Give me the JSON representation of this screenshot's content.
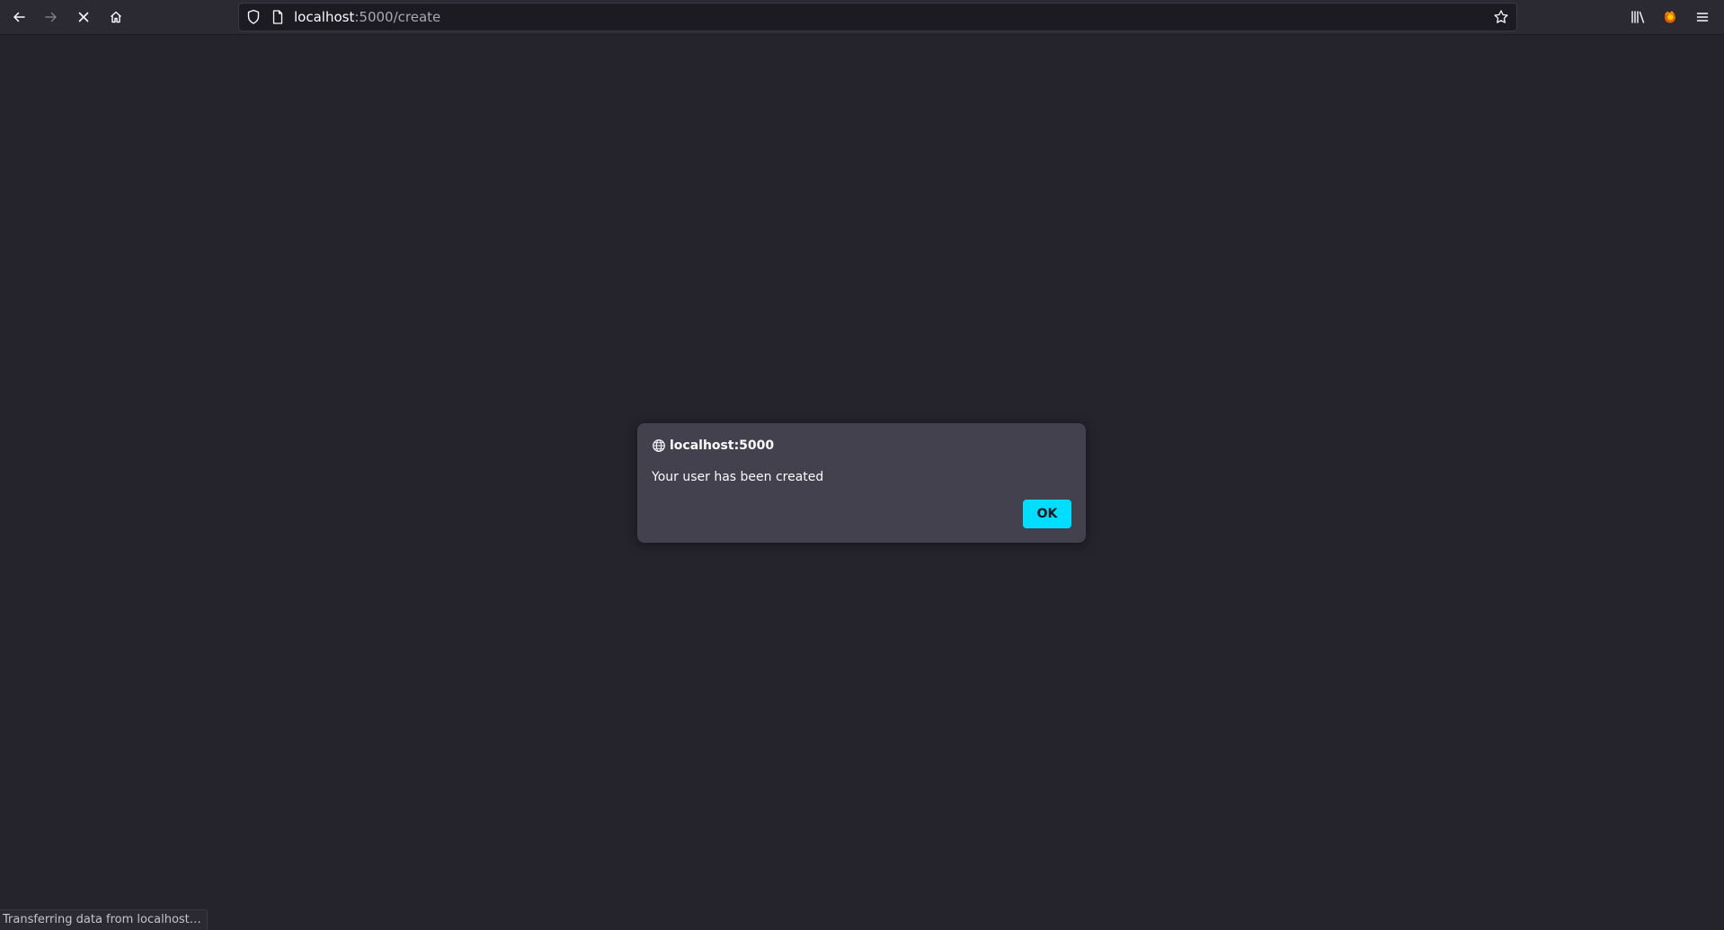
{
  "toolbar": {
    "back_icon": "arrow-left-icon",
    "forward_icon": "arrow-right-icon",
    "stop_icon": "close-icon",
    "home_icon": "home-icon",
    "library_icon": "library-icon",
    "extension_icon": "firefox-icon",
    "menu_icon": "hamburger-menu-icon"
  },
  "urlbar": {
    "host": "localhost",
    "path": ":5000/create",
    "shield_icon": "shield-icon",
    "page_icon": "page-icon",
    "star_icon": "star-icon"
  },
  "dialog": {
    "origin_icon": "globe-icon",
    "title": "localhost:5000",
    "message": "Your user has been created",
    "ok_label": "OK"
  },
  "status": {
    "text": "Transferring data from localhost…"
  },
  "colors": {
    "content_bg": "#25242d",
    "toolbar_bg": "#2b2a33",
    "dialog_bg": "#42414d",
    "accent": "#00ddff"
  }
}
